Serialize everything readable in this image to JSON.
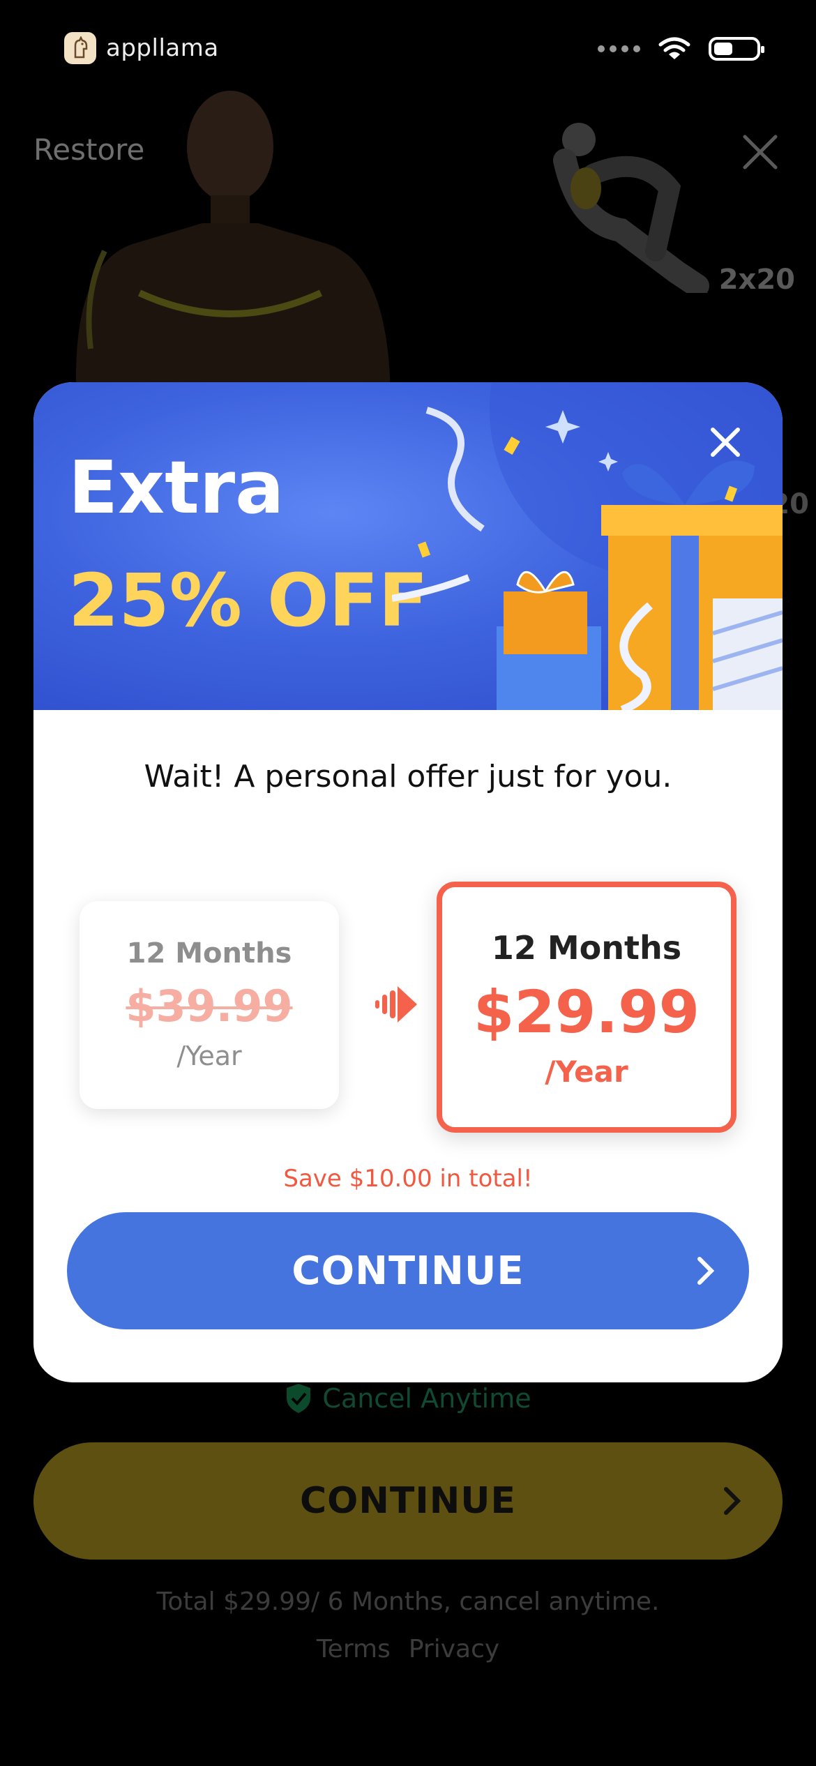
{
  "status_bar": {
    "brand_name": "appllama",
    "icons": [
      "llama-logo-icon",
      "signal-dots-icon",
      "wifi-icon",
      "battery-icon"
    ]
  },
  "background": {
    "restore_label": "Restore",
    "exercise_reps": "2x20",
    "exercise_reps_2": "20",
    "cancel_anytime": "Cancel Anytime",
    "continue_label": "CONTINUE",
    "total_text": "Total $29.99/ 6 Months, cancel anytime.",
    "terms_label": "Terms",
    "privacy_label": "Privacy"
  },
  "modal": {
    "banner_title": "Extra",
    "banner_discount": "25% OFF",
    "subtitle": "Wait! A personal offer just for you.",
    "old_plan": {
      "duration": "12 Months",
      "price": "$39.99",
      "period": "/Year"
    },
    "new_plan": {
      "duration": "12 Months",
      "price": "$29.99",
      "period": "/Year"
    },
    "savings_text": "Save $10.00 in total!",
    "continue_label": "CONTINUE"
  },
  "colors": {
    "accent_blue": "#4574df",
    "offer_red": "#f4624b",
    "discount_yellow": "#ffd45a",
    "struck_price": "#f6aea2"
  }
}
